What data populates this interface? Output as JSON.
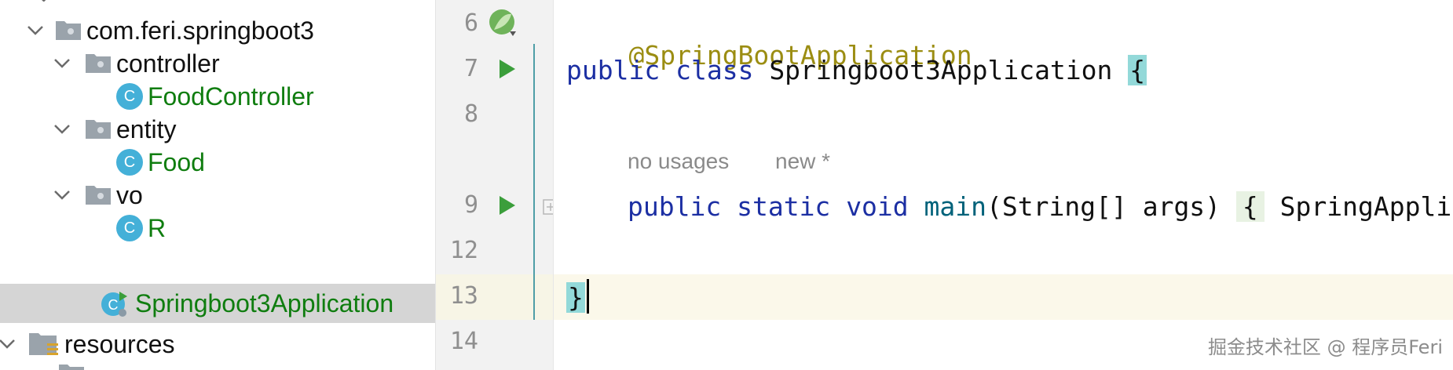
{
  "project_tree": {
    "items": [
      {
        "label": "com.feri.springboot3",
        "kind": "package"
      },
      {
        "label": "controller",
        "kind": "package"
      },
      {
        "label": "FoodController",
        "kind": "class"
      },
      {
        "label": "entity",
        "kind": "package"
      },
      {
        "label": "Food",
        "kind": "class"
      },
      {
        "label": "vo",
        "kind": "package"
      },
      {
        "label": "R",
        "kind": "class"
      },
      {
        "label": "Springboot3Application",
        "kind": "spring-boot-class",
        "selected": true
      },
      {
        "label": "resources",
        "kind": "resources-folder"
      }
    ]
  },
  "gutter": {
    "line_numbers": [
      "6",
      "7",
      "8",
      "9",
      "12",
      "13",
      "14"
    ]
  },
  "editor": {
    "annotation": "@SpringBootApplication",
    "class_line": {
      "kw1": "public",
      "kw2": "class",
      "name": "Springboot3Application",
      "brace": "{"
    },
    "inlay_hint": {
      "usages": "no usages",
      "author": "new *"
    },
    "main_line": {
      "kw1": "public",
      "kw2": "static",
      "kw3": "void",
      "method": "main",
      "params": "(String[] args)",
      "brace": "{",
      "body": "SpringApplic"
    },
    "closing_brace": "}"
  },
  "watermark": "掘金技术社区 @ 程序员Feri",
  "colors": {
    "keyword": "#1c2fa3",
    "annotation": "#9b8d12",
    "class_name_green": "#0f7d0f",
    "class_icon": "#44b0d8",
    "run_icon": "#3b9e3b",
    "brace_highlight": "#93d9d9"
  }
}
